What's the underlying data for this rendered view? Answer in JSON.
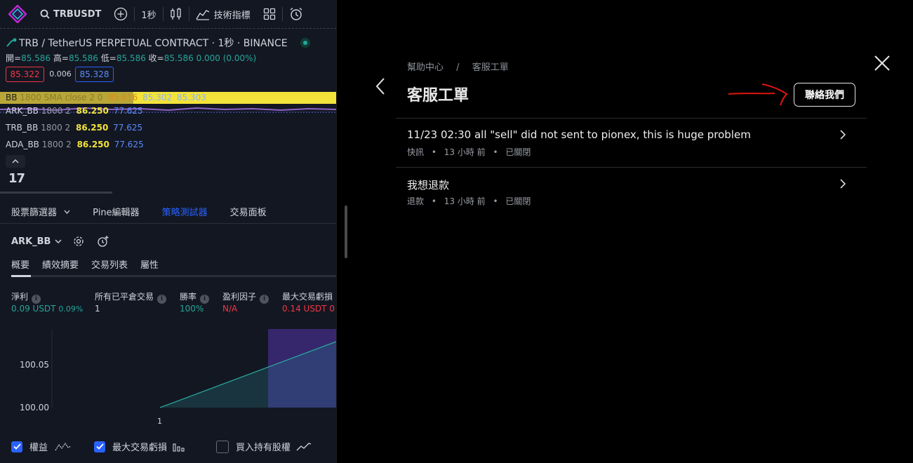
{
  "toolbar": {
    "symbol": "TRBUSDT",
    "interval": "1秒",
    "indicators_label": "技術指標"
  },
  "chart": {
    "symbol_line": "TRB / TetherUS PERPETUAL CONTRACT · 1秒 · BINANCE",
    "ohlc": {
      "open_label": "開=",
      "open": "85.586",
      "high_label": "高=",
      "high": "85.586",
      "low_label": "低=",
      "low": "85.586",
      "close_label": "收=",
      "close": "85.586",
      "change": "0.000 (0.00%)"
    },
    "bid": "85.322",
    "spread": "0.006",
    "ask": "85.328",
    "indicators": [
      {
        "name": "BB",
        "params": "1800 SMA close 2 0",
        "v1": "85.616",
        "v2": "85.302",
        "v3": "85.303"
      },
      {
        "name": "ARK_BB",
        "params": "1800 2",
        "v1": "86.250",
        "v2": "77.625"
      },
      {
        "name": "TRB_BB",
        "params": "1800 2",
        "v1": "86.250",
        "v2": "77.625"
      },
      {
        "name": "ADA_BB",
        "params": "1800 2",
        "v1": "86.250",
        "v2": "77.625"
      }
    ],
    "tv_logo": "17"
  },
  "bottom_tabs": [
    "股票篩選器",
    "Pine編輯器",
    "策略測試器",
    "交易面板"
  ],
  "strategy": {
    "name": "ARK_BB",
    "subtabs": [
      "概要",
      "績效摘要",
      "交易列表",
      "屬性"
    ],
    "metrics": [
      {
        "label": "淨利",
        "value": "0.09 USDT",
        "sub": "0.09%",
        "color": "#26a69a"
      },
      {
        "label": "所有已平倉交易",
        "value": "1",
        "color": "#d1d4dc"
      },
      {
        "label": "勝率",
        "value": "100%",
        "color": "#26a69a"
      },
      {
        "label": "盈利因子",
        "value": "N/A",
        "color": "#f23645"
      },
      {
        "label": "最大交易虧損",
        "value": "0.14 USDT",
        "sub": "0",
        "color": "#f23645"
      }
    ],
    "y_ticks": [
      "100.05",
      "100.00"
    ],
    "x_tick": "1",
    "checkboxes": [
      {
        "label": "權益",
        "checked": true
      },
      {
        "label": "最大交易虧損",
        "checked": true
      },
      {
        "label": "買入持有股權",
        "checked": false
      }
    ]
  },
  "help": {
    "breadcrumb_root": "幫助中心",
    "breadcrumb_sep": "/",
    "breadcrumb_current": "客服工單",
    "title": "客服工單",
    "contact_button": "聯絡我們",
    "tickets": [
      {
        "title": "11/23 02:30 all \"sell\" did not sent to pionex, this is huge problem",
        "category": "快訊",
        "time": "13 小時 前",
        "status": "已關閉"
      },
      {
        "title": "我想退款",
        "category": "退款",
        "time": "13 小時 前",
        "status": "已關閉"
      }
    ]
  },
  "colors": {
    "accent_blue": "#2962ff",
    "green": "#26a69a",
    "red": "#f23645",
    "yellow": "#f2e33a",
    "annotation": "#e0140f"
  }
}
